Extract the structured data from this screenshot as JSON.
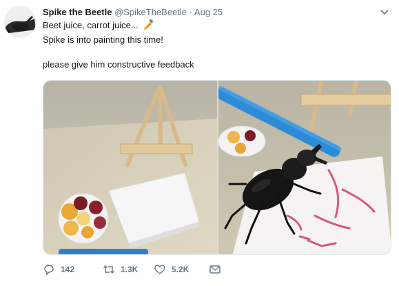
{
  "tweet": {
    "author_name": "Spike the Beetle",
    "handle": "@SpikeTheBeetle",
    "separator": "·",
    "date": "Aug 25",
    "lines": [
      "Beet juice, carrot juice...",
      "Spike is into painting this time!",
      "please give him constructive feedback"
    ],
    "emoji": "carrot-icon"
  },
  "actions": {
    "replies": "142",
    "retweets": "1.3K",
    "likes": "5.2K"
  },
  "colors": {
    "text": "#14171a",
    "secondary": "#657786"
  }
}
